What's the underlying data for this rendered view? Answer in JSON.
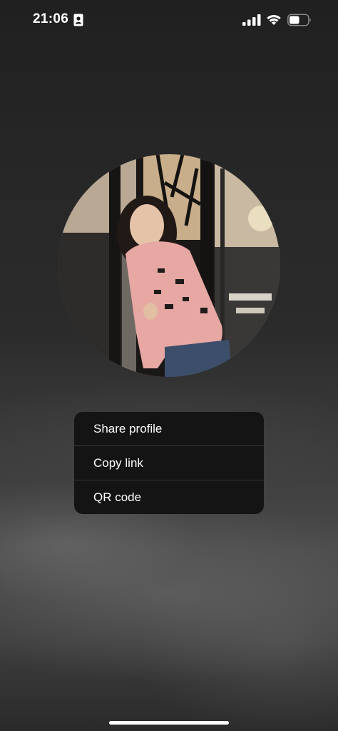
{
  "status_bar": {
    "time": "21:06",
    "contact_icon": "person-card-icon",
    "signal_icon": "cellular-signal-icon",
    "wifi_icon": "wifi-icon",
    "battery_icon": "battery-icon",
    "battery_level": 0.55
  },
  "profile": {
    "photo_icon": "profile-photo"
  },
  "context_menu": {
    "items": [
      {
        "label": "Share profile"
      },
      {
        "label": "Copy link"
      },
      {
        "label": "QR code"
      }
    ]
  },
  "colors": {
    "menu_background": "#141414",
    "menu_divider": "#363636",
    "text": "#ffffff"
  }
}
